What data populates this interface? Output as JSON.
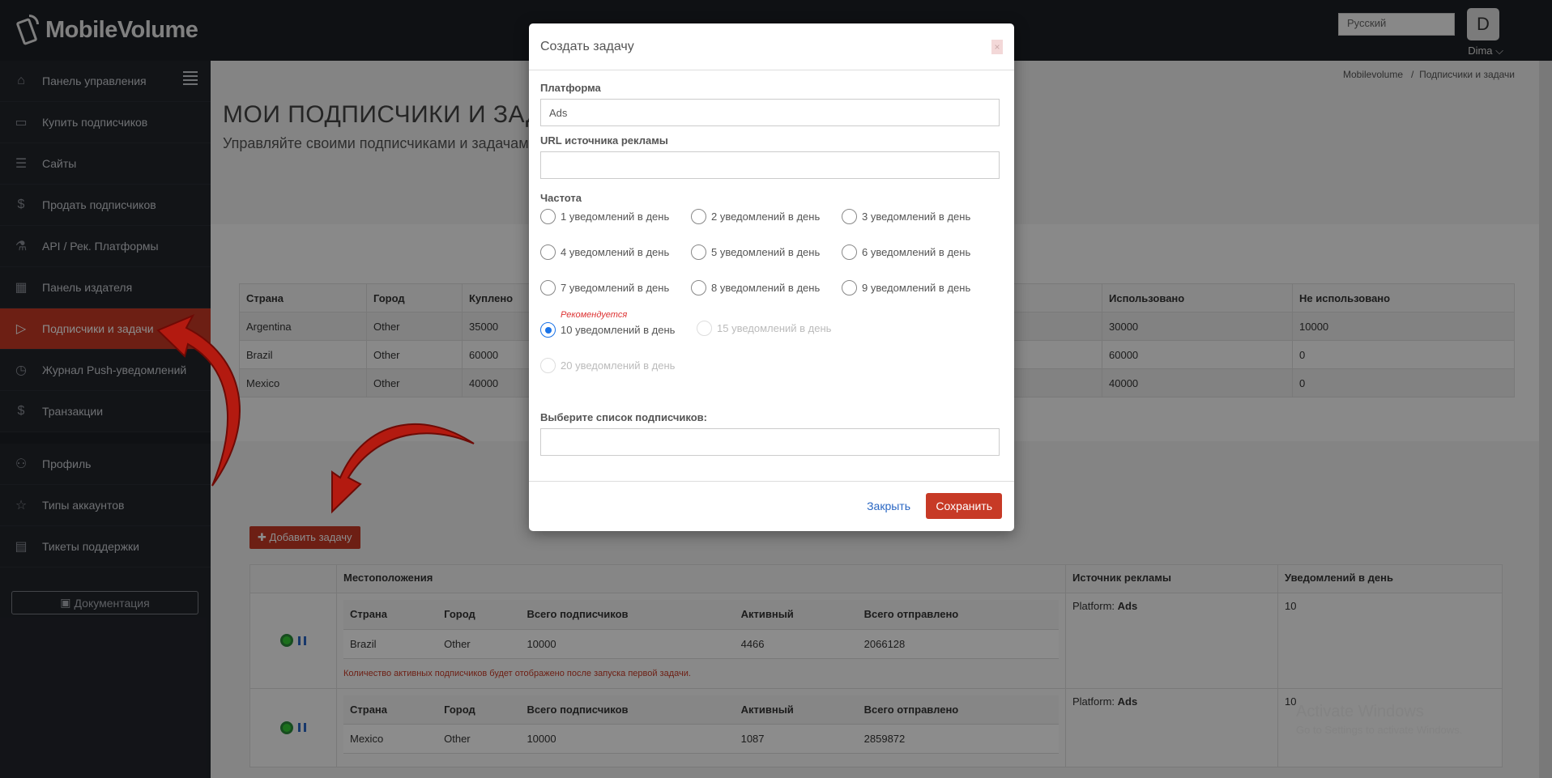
{
  "brand": {
    "name": "MobileVolume"
  },
  "topbar": {
    "language": "Русский",
    "avatar_letter": "D",
    "user": "Dima ⌵"
  },
  "sidebar": {
    "items": [
      {
        "label": "Панель управления",
        "icon": "home-icon",
        "glyph": "⌂"
      },
      {
        "label": "Купить подписчиков",
        "icon": "credit-card-icon",
        "glyph": "▭"
      },
      {
        "label": "Сайты",
        "icon": "list-icon",
        "glyph": "☰"
      },
      {
        "label": "Продать подписчиков",
        "icon": "dollar-icon",
        "glyph": "$"
      },
      {
        "label": "API / Рек. Платформы",
        "icon": "flask-icon",
        "glyph": "⚗"
      },
      {
        "label": "Панель издателя",
        "icon": "chart-icon",
        "glyph": "▦"
      },
      {
        "label": "Подписчики и задачи",
        "icon": "play-icon",
        "glyph": "▷"
      },
      {
        "label": "Журнал Push-уведомлений",
        "icon": "clock-icon",
        "glyph": "◷"
      },
      {
        "label": "Транзакции",
        "icon": "dollar-icon",
        "glyph": "$"
      }
    ],
    "items2": [
      {
        "label": "Профиль",
        "icon": "user-icon",
        "glyph": "⚇"
      },
      {
        "label": "Типы аккаунтов",
        "icon": "star-icon",
        "glyph": "☆"
      },
      {
        "label": "Тикеты поддержки",
        "icon": "ticket-icon",
        "glyph": "▤"
      }
    ],
    "doc_label": "Документация"
  },
  "breadcrumb": {
    "home": "Mobilevolume",
    "sep": "/",
    "current": "Подписчики и задачи"
  },
  "page": {
    "title": "МОИ ПОДПИСЧИКИ И ЗАДА",
    "subtitle": "Управляйте своими подписчиками и задачам"
  },
  "summary": {
    "headers": [
      "Страна",
      "Город",
      "Куплено",
      "",
      "Использовано",
      "Не использовано"
    ],
    "rows": [
      [
        "Argentina",
        "Other",
        "35000",
        "",
        "30000",
        "10000"
      ],
      [
        "Brazil",
        "Other",
        "60000",
        "",
        "60000",
        "0"
      ],
      [
        "Mexico",
        "Other",
        "40000",
        "",
        "40000",
        "0"
      ]
    ]
  },
  "add_task_label": "✚ Добавить задачу",
  "tasks": {
    "headers": [
      "",
      "Местоположения",
      "Источник рекламы",
      "Уведомлений в день"
    ],
    "inner_headers": [
      "Страна",
      "Город",
      "Всего подписчиков",
      "Активный",
      "Всего отправлено"
    ],
    "rows": [
      {
        "loc": [
          "Brazil",
          "Other",
          "10000",
          "4466",
          "2066128"
        ],
        "platform_label": "Platform:",
        "platform": "Ads",
        "per_day": "10",
        "note": "Количество активных подписчиков будет отображено после запуска первой задачи."
      },
      {
        "loc": [
          "Mexico",
          "Other",
          "10000",
          "1087",
          "2859872"
        ],
        "platform_label": "Platform:",
        "platform": "Ads",
        "per_day": "10",
        "note": ""
      }
    ]
  },
  "watermark": {
    "line1": "Activate Windows",
    "line2": "Go to Settings to activate Windows."
  },
  "modal": {
    "title": "Создать задачу",
    "close_x": "×",
    "platform_label": "Платформа",
    "platform_value": "Ads",
    "url_label": "URL источника рекламы",
    "url_value": "",
    "freq_label": "Частота",
    "recommend": "Рекомендуется",
    "options": [
      "1 уведомлений в день",
      "2 уведомлений в день",
      "3 уведомлений в день",
      "4 уведомлений в день",
      "5 уведомлений в день",
      "6 уведомлений в день",
      "7 уведомлений в день",
      "8 уведомлений в день",
      "9 уведомлений в день",
      "10 уведомлений в день",
      "15 уведомлений в день",
      "20 уведомлений в день"
    ],
    "list_label": "Выберите список подписчиков:",
    "list_value": "",
    "btn_close": "Закрыть",
    "btn_save": "Сохранить"
  }
}
